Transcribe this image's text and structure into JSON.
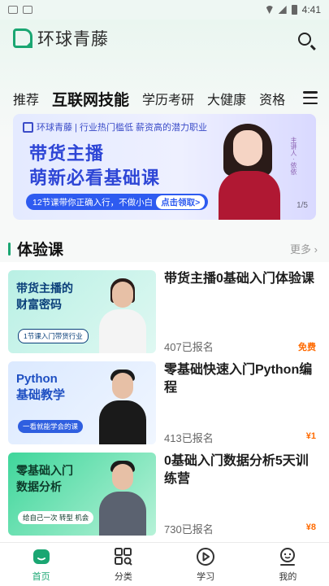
{
  "status_bar": {
    "time": "4:41"
  },
  "header": {
    "app_name": "环球青藤"
  },
  "tabs": [
    "推荐",
    "互联网技能",
    "学历考研",
    "大健康",
    "资格"
  ],
  "banner": {
    "top_line": "环球青藤 | 行业热门槛低 薪资高的潜力职业",
    "title_line1": "带货主播",
    "title_line2": "萌新必看基础课",
    "cta_text": "12节课带你正确入行，不做小白",
    "cta_button": "点击领取>",
    "host_tag": "主讲人 · 依依",
    "page_indicator": "1/5"
  },
  "section": {
    "title": "体验课",
    "more": "更多 ›"
  },
  "courses": [
    {
      "title": "带货主播0基础入门体验课",
      "enrolled": "407已报名",
      "price": "免费",
      "thumb_title": "带货主播的\n财富密码",
      "thumb_pill": "1节课入门带货行业"
    },
    {
      "title": "零基础快速入门Python编程",
      "enrolled": "413已报名",
      "price": "¥1",
      "thumb_title": "Python\n基础教学",
      "thumb_pill": "一看就能学会的课"
    },
    {
      "title": "0基础入门数据分析5天训练营",
      "enrolled": "730已报名",
      "price": "¥8",
      "thumb_title": "零基础入门\n数据分析",
      "thumb_pill": "给自己一次 转型 机会"
    }
  ],
  "bottom_nav": [
    {
      "label": "首页",
      "icon": "home-icon",
      "active": true
    },
    {
      "label": "分类",
      "icon": "category-icon",
      "active": false
    },
    {
      "label": "学习",
      "icon": "play-icon",
      "active": false
    },
    {
      "label": "我的",
      "icon": "profile-icon",
      "active": false
    }
  ],
  "colors": {
    "accent": "#1aa672",
    "price": "#ff6a00",
    "banner_blue": "#2e46d6"
  }
}
